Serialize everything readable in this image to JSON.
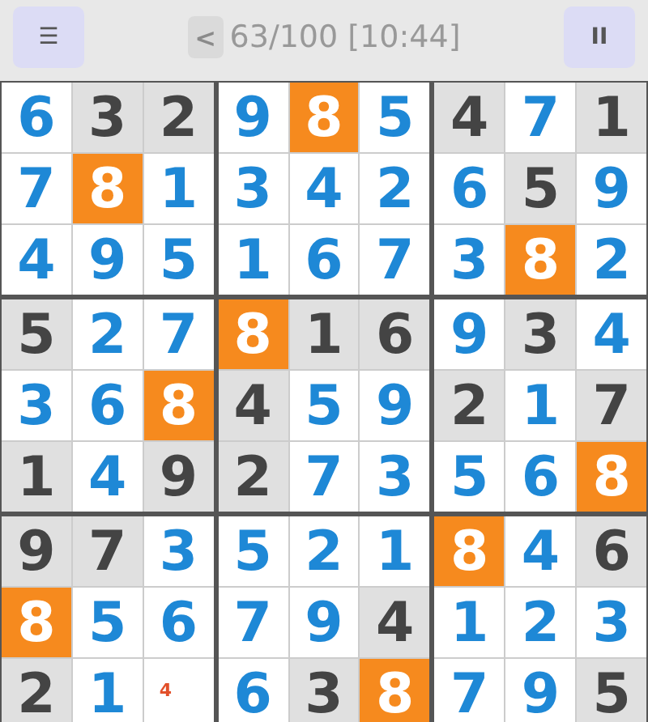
{
  "toolbar": {
    "menu_button": "☰",
    "back_button": "<",
    "title": "63/100 [10:44]",
    "pause_button": "II"
  },
  "grid": [
    [
      {
        "value": "6",
        "kind": "entered"
      },
      {
        "value": "3",
        "kind": "given"
      },
      {
        "value": "2",
        "kind": "given"
      },
      {
        "value": "9",
        "kind": "entered"
      },
      {
        "value": "8",
        "kind": "highlighted"
      },
      {
        "value": "5",
        "kind": "entered"
      },
      {
        "value": "4",
        "kind": "given"
      },
      {
        "value": "7",
        "kind": "entered"
      },
      {
        "value": "1",
        "kind": "given"
      }
    ],
    [
      {
        "value": "7",
        "kind": "entered"
      },
      {
        "value": "8",
        "kind": "highlighted"
      },
      {
        "value": "1",
        "kind": "entered"
      },
      {
        "value": "3",
        "kind": "entered"
      },
      {
        "value": "4",
        "kind": "entered"
      },
      {
        "value": "2",
        "kind": "entered"
      },
      {
        "value": "6",
        "kind": "entered"
      },
      {
        "value": "5",
        "kind": "given"
      },
      {
        "value": "9",
        "kind": "entered"
      }
    ],
    [
      {
        "value": "4",
        "kind": "entered"
      },
      {
        "value": "9",
        "kind": "entered"
      },
      {
        "value": "5",
        "kind": "entered"
      },
      {
        "value": "1",
        "kind": "entered"
      },
      {
        "value": "6",
        "kind": "entered"
      },
      {
        "value": "7",
        "kind": "entered"
      },
      {
        "value": "3",
        "kind": "entered"
      },
      {
        "value": "8",
        "kind": "highlighted"
      },
      {
        "value": "2",
        "kind": "entered"
      }
    ],
    [
      {
        "value": "5",
        "kind": "given"
      },
      {
        "value": "2",
        "kind": "entered"
      },
      {
        "value": "7",
        "kind": "entered"
      },
      {
        "value": "8",
        "kind": "highlighted"
      },
      {
        "value": "1",
        "kind": "given"
      },
      {
        "value": "6",
        "kind": "given"
      },
      {
        "value": "9",
        "kind": "entered"
      },
      {
        "value": "3",
        "kind": "given"
      },
      {
        "value": "4",
        "kind": "entered"
      }
    ],
    [
      {
        "value": "3",
        "kind": "entered"
      },
      {
        "value": "6",
        "kind": "entered"
      },
      {
        "value": "8",
        "kind": "highlighted"
      },
      {
        "value": "4",
        "kind": "given"
      },
      {
        "value": "5",
        "kind": "entered"
      },
      {
        "value": "9",
        "kind": "entered"
      },
      {
        "value": "2",
        "kind": "given"
      },
      {
        "value": "1",
        "kind": "entered"
      },
      {
        "value": "7",
        "kind": "given"
      }
    ],
    [
      {
        "value": "1",
        "kind": "given"
      },
      {
        "value": "4",
        "kind": "entered"
      },
      {
        "value": "9",
        "kind": "given"
      },
      {
        "value": "2",
        "kind": "given"
      },
      {
        "value": "7",
        "kind": "entered"
      },
      {
        "value": "3",
        "kind": "entered"
      },
      {
        "value": "5",
        "kind": "entered"
      },
      {
        "value": "6",
        "kind": "entered"
      },
      {
        "value": "8",
        "kind": "highlighted"
      }
    ],
    [
      {
        "value": "9",
        "kind": "given"
      },
      {
        "value": "7",
        "kind": "given"
      },
      {
        "value": "3",
        "kind": "entered"
      },
      {
        "value": "5",
        "kind": "entered"
      },
      {
        "value": "2",
        "kind": "entered"
      },
      {
        "value": "1",
        "kind": "entered"
      },
      {
        "value": "8",
        "kind": "highlighted"
      },
      {
        "value": "4",
        "kind": "entered"
      },
      {
        "value": "6",
        "kind": "given"
      }
    ],
    [
      {
        "value": "8",
        "kind": "highlighted"
      },
      {
        "value": "5",
        "kind": "entered"
      },
      {
        "value": "6",
        "kind": "entered"
      },
      {
        "value": "7",
        "kind": "entered"
      },
      {
        "value": "9",
        "kind": "entered"
      },
      {
        "value": "4",
        "kind": "given"
      },
      {
        "value": "1",
        "kind": "entered"
      },
      {
        "value": "2",
        "kind": "entered"
      },
      {
        "value": "3",
        "kind": "entered"
      }
    ],
    [
      {
        "value": "2",
        "kind": "given"
      },
      {
        "value": "1",
        "kind": "entered"
      },
      {
        "value": "4",
        "kind": "note"
      },
      {
        "value": "6",
        "kind": "entered"
      },
      {
        "value": "3",
        "kind": "given"
      },
      {
        "value": "8",
        "kind": "highlighted"
      },
      {
        "value": "7",
        "kind": "entered"
      },
      {
        "value": "9",
        "kind": "entered"
      },
      {
        "value": "5",
        "kind": "given"
      }
    ]
  ]
}
